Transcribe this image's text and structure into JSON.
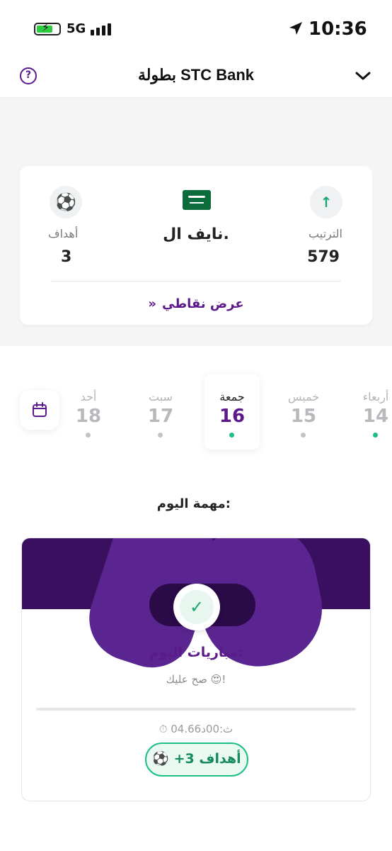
{
  "status_bar": {
    "network": "5G",
    "time": "10:36",
    "icons": [
      "battery-charging-icon",
      "signal-bars-icon",
      "location-arrow-icon"
    ]
  },
  "header": {
    "title": "بطولة STC Bank",
    "help_glyph": "?",
    "icons": [
      "help-icon",
      "chevron-down-icon"
    ]
  },
  "score_card": {
    "rank_label": "الترتيب",
    "rank_value": "579",
    "player_name": "نايف ال.",
    "goals_label": "أهداف",
    "goals_value": "3",
    "points_link": "عرض نقاطي",
    "points_link_arrow": "»",
    "ball_glyph": "⚽",
    "rank_arrow": "↑",
    "flag_icon": "saudi-flag-icon"
  },
  "days": [
    {
      "name": "أربعاء",
      "num": "14",
      "dot": "green"
    },
    {
      "name": "خميس",
      "num": "15",
      "dot": "gray"
    },
    {
      "name": "جمعة",
      "num": "16",
      "dot": "green",
      "active": true
    },
    {
      "name": "سبت",
      "num": "17",
      "dot": "gray"
    },
    {
      "name": "أحد",
      "num": "18",
      "dot": "gray"
    }
  ],
  "mission": {
    "section_title": "مهمة اليوم:",
    "task_title": "مباريات اليوم:",
    "task_subtitle": "صح عليك 😍!",
    "timer": "⏱ 04.66ث:00د",
    "progress": 0.0,
    "goals_pill": "⚽ +3 أهداف",
    "check_glyph": "✓"
  },
  "colors": {
    "brand_purple": "#5b1a8a",
    "banner_dark": "#3b0f60",
    "accent_green": "#1dbf85"
  }
}
